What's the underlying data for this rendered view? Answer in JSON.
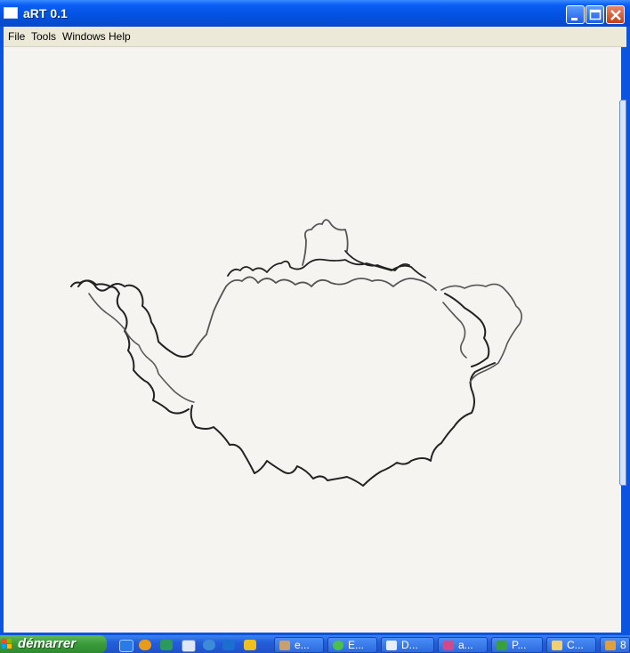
{
  "window": {
    "title": "aRT 0.1",
    "icon": "app-window-icon",
    "controls": [
      "minimize-icon",
      "maximize-icon",
      "close-icon"
    ]
  },
  "menu": {
    "items": [
      "File",
      "Tools",
      "Windows",
      "Help"
    ]
  },
  "canvas": {
    "content": "hand-drawn teapot sketch"
  },
  "taskbar": {
    "start_label": "démarrer",
    "quick_launch": [
      "internet-explorer-icon",
      "media-player-icon",
      "messenger-icon",
      "mail-icon",
      "firefox-icon",
      "eye-icon",
      "lightning-icon"
    ],
    "tasks": [
      {
        "label": "e...",
        "icon": "tool-icon"
      },
      {
        "label": "E...",
        "icon": "globe-icon"
      },
      {
        "label": "D...",
        "icon": "document-icon"
      },
      {
        "label": "a...",
        "icon": "paint-icon"
      },
      {
        "label": "P...",
        "icon": "program-icon"
      },
      {
        "label": "C...",
        "icon": "folder-icon"
      },
      {
        "label": "8",
        "icon": "app-icon"
      }
    ]
  },
  "colors": {
    "titlebar": "#0251e0",
    "menubar": "#ece9d8",
    "canvas": "#f5f4f1",
    "taskbar": "#245edb",
    "start": "#3a9a3a",
    "ink": "#1e1e1e"
  }
}
